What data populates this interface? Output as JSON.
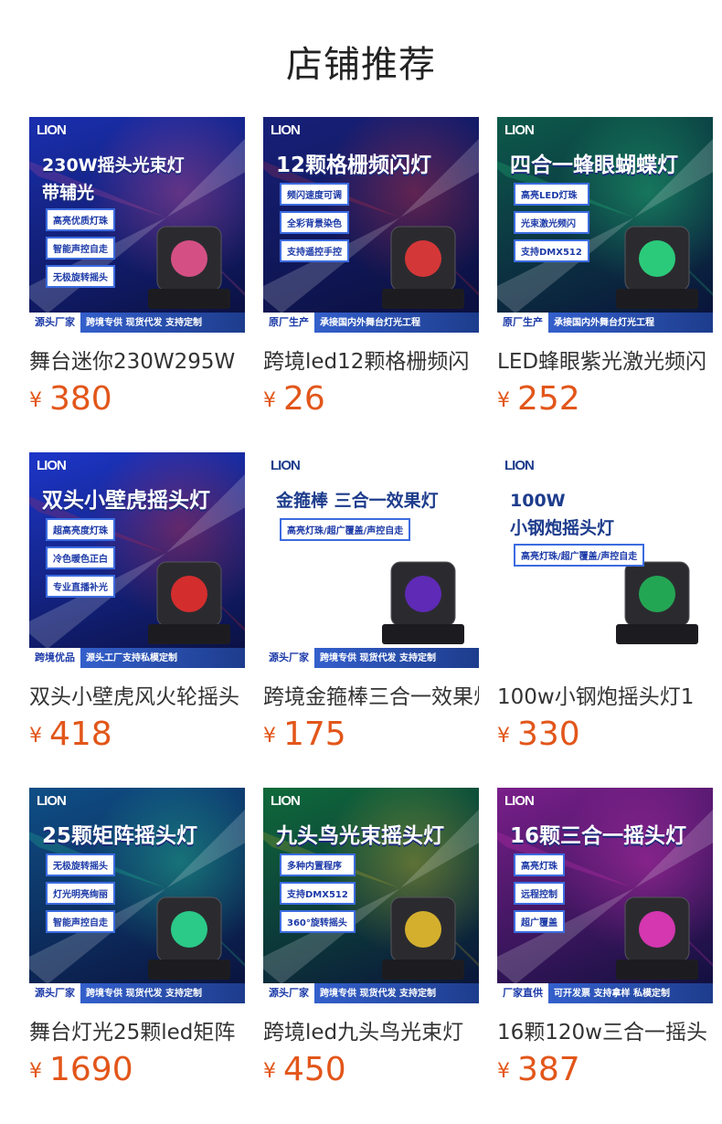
{
  "page_title": "店铺推荐",
  "currency_symbol": "¥",
  "products": [
    {
      "name": "舞台迷你230W295W",
      "price": "380",
      "thumb": {
        "logo": "LION",
        "banner": [
          "230W摇头光束灯",
          "带辅光"
        ],
        "tags": [
          "高亮优质灯珠",
          "智能声控自走",
          "无极旋转摇头"
        ],
        "foot_lead": "源头厂家",
        "foot_text": "跨境专供  现货代发  支持定制",
        "bg": "#1a2fb0",
        "accent": "#ff5a9a"
      }
    },
    {
      "name": "跨境led12颗格栅频闪",
      "price": "26",
      "thumb": {
        "logo": "LION",
        "banner": [
          "12颗格栅频闪灯"
        ],
        "tags": [
          "频闪速度可调",
          "全彩背景染色",
          "支持遥控手控"
        ],
        "foot_lead": "原厂生产",
        "foot_text": "承接国内外舞台灯光工程",
        "bg": "#17207a",
        "accent": "#ff3b3b"
      }
    },
    {
      "name": "LED蜂眼紫光激光频闪",
      "price": "252",
      "thumb": {
        "logo": "LION",
        "banner": [
          "四合一蜂眼蝴蝶灯"
        ],
        "tags": [
          "高亮LED灯珠",
          "光束激光频闪",
          "支持DMX512"
        ],
        "foot_lead": "原厂生产",
        "foot_text": "承接国内外舞台灯光工程",
        "bg": "#0d5a4a",
        "accent": "#2cf28f"
      }
    },
    {
      "name": "双头小壁虎风火轮摇头",
      "price": "418",
      "thumb": {
        "logo": "LION",
        "banner": [
          "双头小壁虎摇头灯"
        ],
        "tags": [
          "超高亮度灯珠",
          "冷色暖色正白",
          "专业直播补光"
        ],
        "foot_lead": "跨境优品",
        "foot_text": "源头工厂支持私模定制",
        "bg": "#1d36c9",
        "accent": "#ff2e2e"
      }
    },
    {
      "name": "跨境金箍棒三合一效果灯",
      "price": "175",
      "thumb": {
        "logo": "LION",
        "banner": [
          "金箍棒 三合一效果灯"
        ],
        "tags": [
          "高亮灯珠/超广覆盖/声控自走"
        ],
        "foot_lead": "源头厂家",
        "foot_text": "跨境专供  现货代发  支持定制",
        "bg": "#ffffff",
        "accent": "#6b2bd8"
      }
    },
    {
      "name": "100w小钢炮摇头灯1",
      "price": "330",
      "thumb": {
        "logo": "LION",
        "banner": [
          "100W",
          "小钢炮摇头灯"
        ],
        "tags": [
          "高亮灯珠/超广覆盖/声控自走"
        ],
        "foot_lead": "",
        "foot_text": "",
        "bg": "#ffffff",
        "accent": "#22c55e"
      }
    },
    {
      "name": "舞台灯光25颗led矩阵",
      "price": "1690",
      "thumb": {
        "logo": "LION",
        "banner": [
          "25颗矩阵摇头灯"
        ],
        "tags": [
          "无极旋转摇头",
          "灯光明亮绚丽",
          "智能声控自走"
        ],
        "foot_lead": "源头厂家",
        "foot_text": "跨境专供  现货代发  支持定制",
        "bg": "#0f4f86",
        "accent": "#2cf2a0"
      }
    },
    {
      "name": "跨境led九头鸟光束灯",
      "price": "450",
      "thumb": {
        "logo": "LION",
        "banner": [
          "九头鸟光束摇头灯"
        ],
        "tags": [
          "多种内置程序",
          "支持DMX512",
          "360°旋转摇头"
        ],
        "foot_lead": "源头厂家",
        "foot_text": "跨境专供  现货代发  支持定制",
        "bg": "#0f6a3a",
        "accent": "#ffd12e"
      }
    },
    {
      "name": "16颗120w三合一摇头",
      "price": "387",
      "thumb": {
        "logo": "LION",
        "banner": [
          "16颗三合一摇头灯"
        ],
        "tags": [
          "高亮灯珠",
          "远程控制",
          "超广覆盖"
        ],
        "foot_lead": "厂家直供",
        "foot_text": "可开发票  支持拿样  私模定制",
        "bg": "#7a1f8a",
        "accent": "#ff3bd0"
      }
    }
  ]
}
